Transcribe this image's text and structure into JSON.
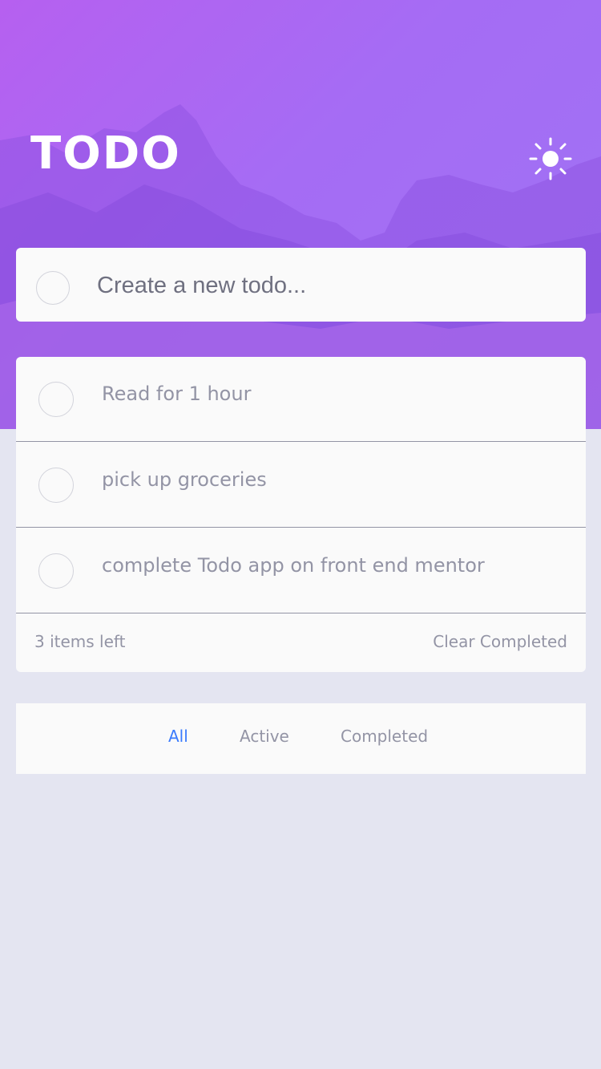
{
  "header": {
    "title": "TODO",
    "theme_icon": "sun-icon"
  },
  "new_todo": {
    "placeholder": "Create a new todo...",
    "value": ""
  },
  "todos": [
    {
      "text": "Read for 1 hour",
      "completed": false
    },
    {
      "text": "pick up groceries",
      "completed": false
    },
    {
      "text": "complete Todo app on front end mentor",
      "completed": false
    }
  ],
  "footer": {
    "items_left": "3 items left",
    "clear_completed": "Clear Completed"
  },
  "filters": {
    "all": "All",
    "active": "Active",
    "completed": "Completed",
    "selected": "All"
  },
  "colors": {
    "hero_gradient_start": "#b660f0",
    "hero_gradient_end": "#9f73f3",
    "page_background": "#e4e5f1",
    "card_background": "#fafafa",
    "text_muted": "#9394a5",
    "accent_blue": "#3a7bfd"
  }
}
